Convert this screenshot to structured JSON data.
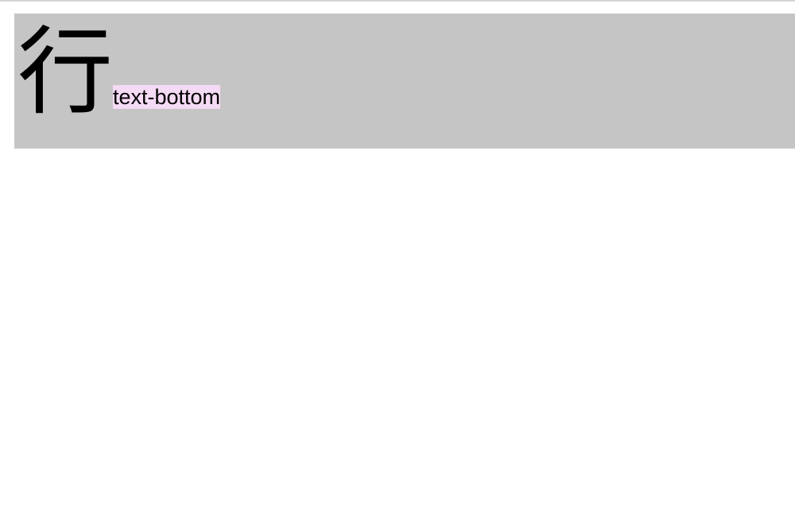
{
  "demo": {
    "big_glyph": "行",
    "small_label": "text-bottom"
  },
  "colors": {
    "box_bg": "#c5c5c5",
    "highlight_bg": "#f4daf4",
    "border": "#d5d5d5"
  }
}
